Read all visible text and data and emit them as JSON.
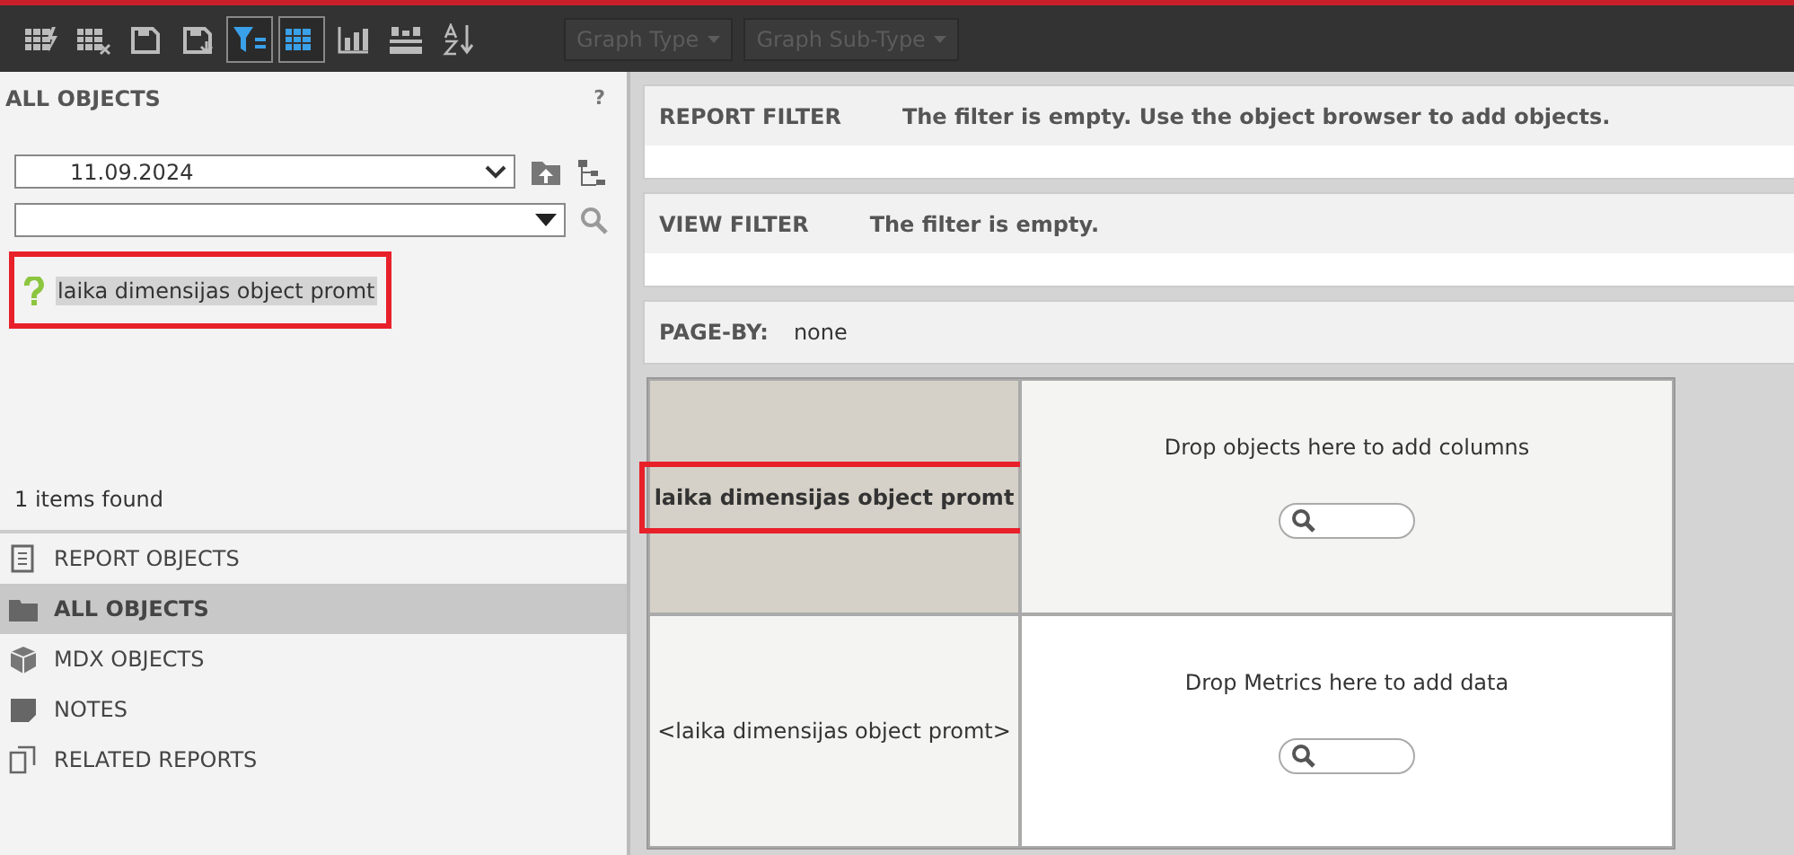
{
  "toolbar": {
    "buttons": [
      {
        "kind": "grid-bolt",
        "selected": false
      },
      {
        "kind": "grid-x",
        "selected": false
      },
      {
        "kind": "save",
        "selected": false
      },
      {
        "kind": "save-down",
        "selected": false
      },
      {
        "kind": "filter",
        "selected": true
      },
      {
        "kind": "grid",
        "selected": true
      },
      {
        "kind": "bars",
        "selected": false
      },
      {
        "kind": "layout",
        "selected": false
      },
      {
        "kind": "sort",
        "selected": false
      }
    ],
    "dropdowns": [
      {
        "label": "Graph Type",
        "disabled": true
      },
      {
        "label": "Graph Sub-Type",
        "disabled": true
      }
    ]
  },
  "browser": {
    "title": "ALL OBJECTS",
    "help": "?",
    "folder": {
      "value": "11.09.2024"
    },
    "results": [
      {
        "label": "laika dimensijas object promt",
        "selected": true,
        "highlighted": true
      }
    ],
    "count": "1 items found",
    "nav": [
      {
        "label": "REPORT OBJECTS",
        "kind": "report",
        "selected": false
      },
      {
        "label": "ALL OBJECTS",
        "kind": "folder",
        "selected": true
      },
      {
        "label": "MDX OBJECTS",
        "kind": "cube",
        "selected": false
      },
      {
        "label": "NOTES",
        "kind": "note",
        "selected": false
      },
      {
        "label": "RELATED REPORTS",
        "kind": "related",
        "selected": false
      }
    ]
  },
  "filters": [
    {
      "label": "REPORT FILTER",
      "text": "The filter is empty. Use the object browser to add objects."
    },
    {
      "label": "VIEW FILTER",
      "text": "The filter is empty."
    }
  ],
  "page_by": {
    "label": "PAGE-BY:",
    "value": "none"
  },
  "grid": {
    "row_header": {
      "label": "laika dimensijas object promt",
      "highlighted": true
    },
    "columns_drop": "Drop objects here to add columns",
    "row_value": "<laika dimensijas object promt>",
    "metrics_drop": "Drop Metrics here to add data"
  }
}
